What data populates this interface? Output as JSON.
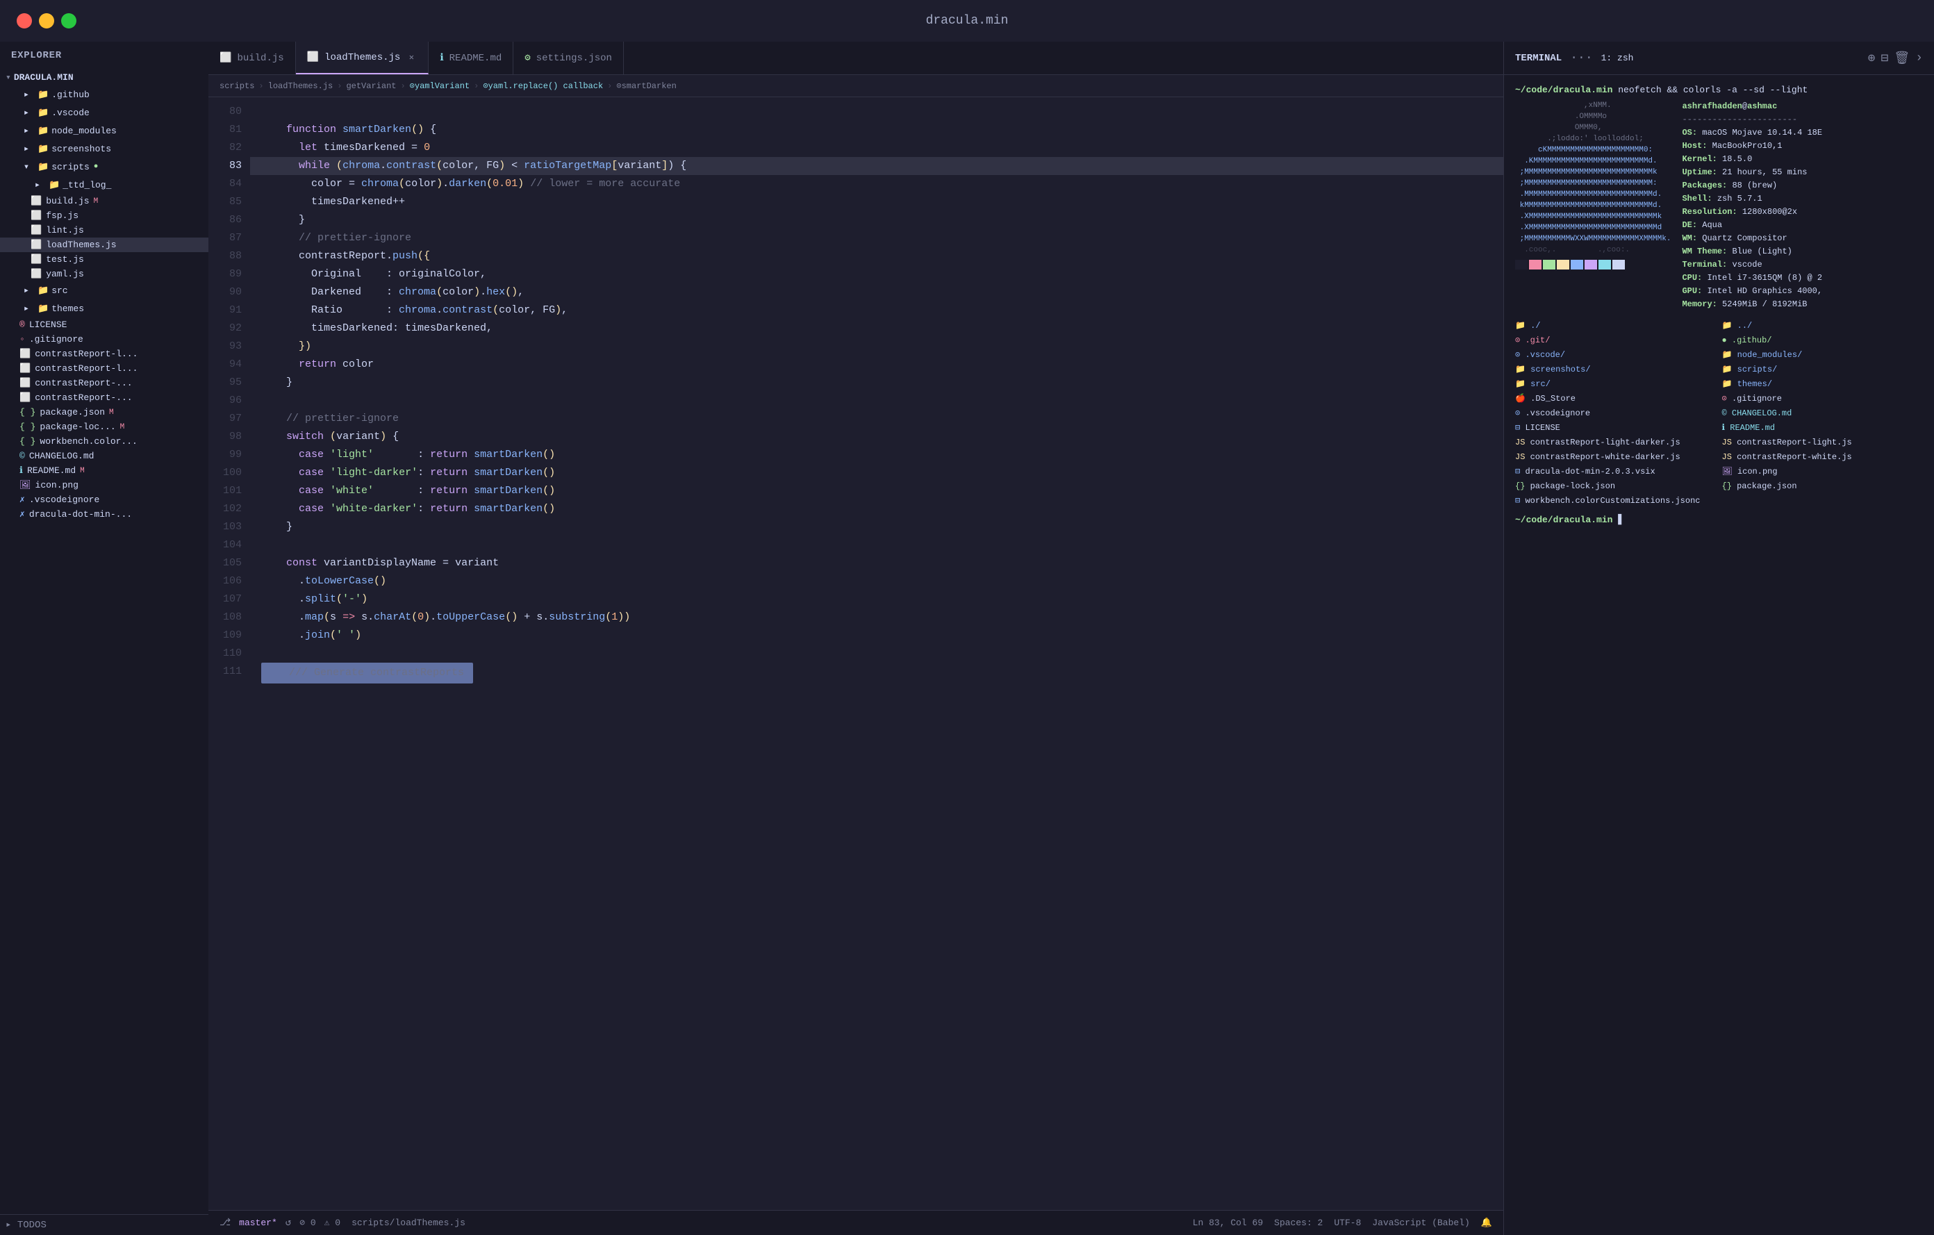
{
  "titlebar": {
    "title": "dracula.min"
  },
  "sidebar": {
    "header": "EXPLORER",
    "project_name": "DRACULA.MIN",
    "items": [
      {
        "id": "github",
        "label": ".github",
        "type": "folder",
        "indent": 1
      },
      {
        "id": "vscode",
        "label": ".vscode",
        "type": "folder",
        "indent": 1
      },
      {
        "id": "node_modules",
        "label": "node_modules",
        "type": "folder",
        "indent": 1
      },
      {
        "id": "screenshots",
        "label": "screenshots",
        "type": "folder",
        "indent": 1
      },
      {
        "id": "scripts",
        "label": "scripts",
        "type": "folder",
        "indent": 1,
        "badge": "●"
      },
      {
        "id": "_ttd_log_",
        "label": "_ttd_log_",
        "type": "folder",
        "indent": 2
      },
      {
        "id": "build.js",
        "label": "build.js",
        "type": "js",
        "indent": 2,
        "badge": "M"
      },
      {
        "id": "fsp.js",
        "label": "fsp.js",
        "type": "js",
        "indent": 2
      },
      {
        "id": "lint.js",
        "label": "lint.js",
        "type": "js",
        "indent": 2
      },
      {
        "id": "loadThemes.js",
        "label": "loadThemes.js",
        "type": "js",
        "indent": 2,
        "active": true
      },
      {
        "id": "test.js",
        "label": "test.js",
        "type": "js",
        "indent": 2
      },
      {
        "id": "yaml.js",
        "label": "yaml.js",
        "type": "js",
        "indent": 2
      },
      {
        "id": "src",
        "label": "src",
        "type": "folder",
        "indent": 1
      },
      {
        "id": "themes",
        "label": "themes",
        "type": "folder",
        "indent": 1
      },
      {
        "id": "LICENSE",
        "label": "LICENSE",
        "type": "license",
        "indent": 1
      },
      {
        "id": ".gitignore",
        "label": ".gitignore",
        "type": "gitignore",
        "indent": 1
      },
      {
        "id": "contrastReport-l1",
        "label": "contrastReport-l...",
        "type": "js",
        "indent": 1
      },
      {
        "id": "contrastReport-l2",
        "label": "contrastReport-l...",
        "type": "js",
        "indent": 1
      },
      {
        "id": "contrastReport-3",
        "label": "contrastReport-...",
        "type": "js",
        "indent": 1
      },
      {
        "id": "contrastReport-4",
        "label": "contrastReport-...",
        "type": "js",
        "indent": 1
      },
      {
        "id": "package.json",
        "label": "package.json",
        "type": "json",
        "indent": 1,
        "badge": "M"
      },
      {
        "id": "package-loc",
        "label": "package-loc...",
        "type": "json",
        "indent": 1,
        "badge": "M"
      },
      {
        "id": "workbench.color",
        "label": "workbench.color...",
        "type": "json",
        "indent": 1
      },
      {
        "id": "CHANGELOG.md",
        "label": "CHANGELOG.md",
        "type": "md",
        "indent": 1
      },
      {
        "id": "README.md",
        "label": "README.md",
        "type": "md",
        "indent": 1,
        "badge": "M"
      },
      {
        "id": "icon.png",
        "label": "icon.png",
        "type": "png",
        "indent": 1
      },
      {
        "id": ".vscodeignore",
        "label": ".vscodeignore",
        "type": "vscode",
        "indent": 1
      },
      {
        "id": "dracula-dot-min",
        "label": "dracula-dot-min-...",
        "type": "vsix",
        "indent": 1
      }
    ],
    "todos": "TODOS"
  },
  "tabs": [
    {
      "id": "build.js",
      "label": "build.js",
      "icon": "📄",
      "active": false,
      "closable": false
    },
    {
      "id": "loadThemes.js",
      "label": "loadThemes.js",
      "icon": "📄",
      "active": true,
      "closable": true
    },
    {
      "id": "README.md",
      "label": "README.md",
      "icon": "ℹ️",
      "active": false,
      "closable": false
    },
    {
      "id": "settings.json",
      "label": "settings.json",
      "icon": "⚙️",
      "active": false,
      "closable": false
    }
  ],
  "breadcrumb": {
    "parts": [
      "scripts",
      "loadThemes.js",
      "getVariant",
      "yamlVariant",
      "yaml.replace() callback",
      "smartDarken"
    ]
  },
  "code": {
    "filename": "loadThemes.js",
    "lines": [
      {
        "num": 80,
        "content": ""
      },
      {
        "num": 81,
        "content": "    function smartDarken() {"
      },
      {
        "num": 82,
        "content": "      let timesDarkened = 0"
      },
      {
        "num": 83,
        "content": "      while (chroma.contrast(color, FG) < ratioTargetMap[variant]) {",
        "highlighted": true
      },
      {
        "num": 84,
        "content": "        color = chroma(color).darken(0.01) // lower = more accurate"
      },
      {
        "num": 85,
        "content": "        timesDarkened++"
      },
      {
        "num": 86,
        "content": "      }"
      },
      {
        "num": 87,
        "content": "      // prettier-ignore"
      },
      {
        "num": 88,
        "content": "      contrastReport.push({"
      },
      {
        "num": 89,
        "content": "        Original    : originalColor,"
      },
      {
        "num": 90,
        "content": "        Darkened    : chroma(color).hex(),"
      },
      {
        "num": 91,
        "content": "        Ratio       : chroma.contrast(color, FG),"
      },
      {
        "num": 92,
        "content": "        timesDarkened: timesDarkened,"
      },
      {
        "num": 93,
        "content": "      })"
      },
      {
        "num": 94,
        "content": "      return color"
      },
      {
        "num": 95,
        "content": "    }"
      },
      {
        "num": 96,
        "content": ""
      },
      {
        "num": 97,
        "content": "    // prettier-ignore"
      },
      {
        "num": 98,
        "content": "    switch (variant) {"
      },
      {
        "num": 99,
        "content": "      case 'light'       : return smartDarken()"
      },
      {
        "num": 100,
        "content": "      case 'light-darker': return smartDarken()"
      },
      {
        "num": 101,
        "content": "      case 'white'       : return smartDarken()"
      },
      {
        "num": 102,
        "content": "      case 'white-darker': return smartDarken()"
      },
      {
        "num": 103,
        "content": "    }"
      },
      {
        "num": 104,
        "content": ""
      },
      {
        "num": 105,
        "content": "    const variantDisplayName = variant"
      },
      {
        "num": 106,
        "content": "      .toLowerCase()"
      },
      {
        "num": 107,
        "content": "      .split('-')"
      },
      {
        "num": 108,
        "content": "      .map(s => s.charAt(0).toUpperCase() + s.substring(1))"
      },
      {
        "num": 109,
        "content": "      .join(' ')"
      },
      {
        "num": 110,
        "content": ""
      },
      {
        "num": 111,
        "content": "    /// Generate contrastReports",
        "selected": true
      }
    ]
  },
  "terminal": {
    "header_title": "TERMINAL",
    "tab_label": "1: zsh",
    "neofetch_cmd": "~/code/dracula.min neofetch && colorls -a --sd --light",
    "system_info": {
      "user": "ashrafhadden@ashmac",
      "os": "OS: macOS Mojave 10.14.4 18E",
      "host": "Host: MacBookPro10,1",
      "kernel": "Kernel: 18.5.0",
      "uptime": "Uptime: 21 hours, 55 mins",
      "packages": "Packages: 88 (brew)",
      "shell": "Shell: zsh 5.7.1",
      "resolution": "Resolution: 1280x800@2x",
      "de": "DE: Aqua",
      "wm": "WM: Quartz Compositor",
      "wm_theme": "WM Theme: Blue (Light)",
      "terminal": "Terminal: vscode",
      "cpu": "CPU: Intel i7-3615QM (8) @ 2",
      "gpu": "GPU: Intel HD Graphics 4000,",
      "memory": "Memory: 5249MiB / 8192MiB"
    },
    "file_listing": [
      {
        "name": "./",
        "type": "dir"
      },
      {
        "name": "../",
        "type": "dir"
      },
      {
        "name": ".git/",
        "type": "git"
      },
      {
        "name": ".github/",
        "type": "github"
      },
      {
        "name": ".vscode/",
        "type": "vscode"
      },
      {
        "name": "node_modules/",
        "type": "dir"
      },
      {
        "name": "screenshots/",
        "type": "dir"
      },
      {
        "name": "scripts/",
        "type": "dir"
      },
      {
        "name": "src/",
        "type": "dir"
      },
      {
        "name": "themes/",
        "type": "dir"
      },
      {
        "name": ".DS_Store",
        "type": "file"
      },
      {
        "name": ".gitignore",
        "type": "git"
      },
      {
        "name": ".vscodeignore",
        "type": "vscode"
      },
      {
        "name": "CHANGELOG.md",
        "type": "md"
      },
      {
        "name": "LICENSE",
        "type": "file"
      },
      {
        "name": "README.md",
        "type": "md"
      },
      {
        "name": "contrastReport-light-darker.js",
        "type": "js"
      },
      {
        "name": "contrastReport-light.js",
        "type": "js"
      },
      {
        "name": "contrastReport-white-darker.js",
        "type": "js"
      },
      {
        "name": "contrastReport-white.js",
        "type": "js"
      },
      {
        "name": "dracula-dot-min-2.0.3.vsix",
        "type": "vsix"
      },
      {
        "name": "icon.png",
        "type": "png"
      },
      {
        "name": "package-lock.json",
        "type": "json"
      },
      {
        "name": "package.json",
        "type": "json"
      },
      {
        "name": "workbench.colorCustomizations.jsonc",
        "type": "jsonc"
      }
    ],
    "prompt": "~/code/dracula.min"
  },
  "status_bar": {
    "branch": "master*",
    "sync": "↺",
    "errors": "⊘ 0",
    "warnings": "⚠ 0",
    "filepath": "scripts/loadThemes.js",
    "line_col": "Ln 83, Col 69",
    "spaces": "Spaces: 2",
    "encoding": "UTF-8",
    "language": "JavaScript (Babel)",
    "bell": "🔔"
  }
}
